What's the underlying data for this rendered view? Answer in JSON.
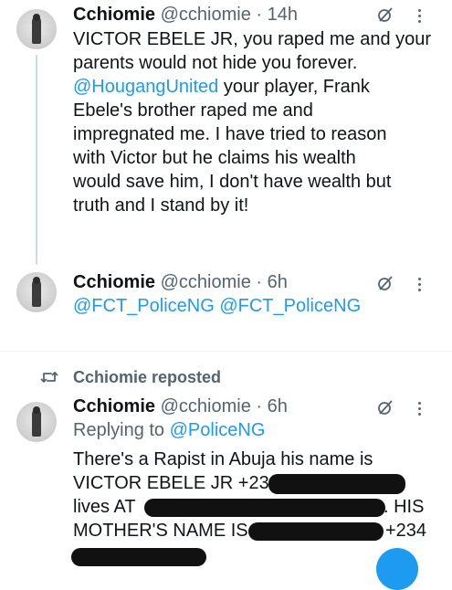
{
  "post1": {
    "name": "Cchiomie",
    "handle": "@cchiomie",
    "separator": "·",
    "time": "14h",
    "lines": [
      "VICTOR EBELE JR, you raped me and your",
      "parents would not hide you forever.",
      "your player, Frank",
      "Ebele's brother raped me and",
      "impregnated me. I have tried to reason",
      "with Victor but he claims his wealth",
      "would save him, I don't have wealth but",
      "truth and I stand by it!"
    ],
    "mention": "@HougangUnited"
  },
  "post2": {
    "name": "Cchiomie",
    "handle": "@cchiomie",
    "separator": "·",
    "time": "6h",
    "mentions": [
      "@FCT_PoliceNG",
      "@FCT_PoliceNG"
    ]
  },
  "repost": {
    "label": "Cchiomie reposted"
  },
  "post3": {
    "name": "Cchiomie",
    "handle": "@cchiomie",
    "separator": "·",
    "time": "6h",
    "replying_prefix": "Replying to",
    "replying_to": "@PoliceNG",
    "lines": [
      "There's a Rapist in Abuja his name is",
      "VICTOR EBELE JR +234",
      "lives  AT",
      ". HIS",
      "MOTHER'S NAME IS",
      "+234"
    ]
  },
  "colors": {
    "text": "#0f1419",
    "secondary": "#536471",
    "link": "#1d9bf0",
    "redaction": "#111111"
  },
  "icons": [
    "grok-icon",
    "more-icon",
    "repost-icon",
    "avatar"
  ]
}
